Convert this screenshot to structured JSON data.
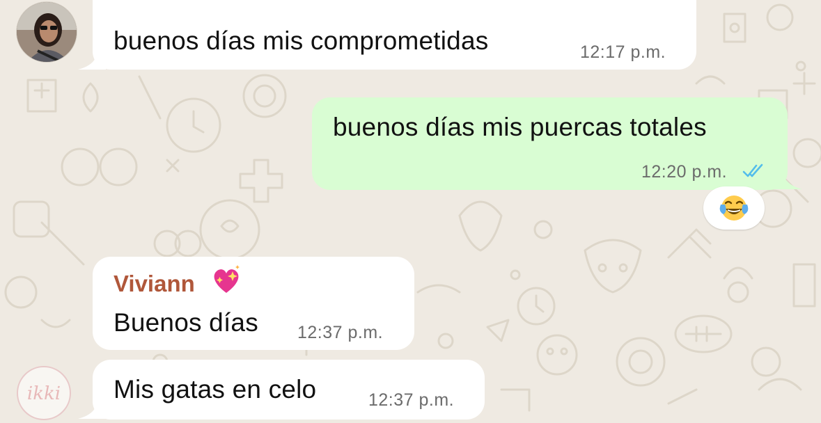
{
  "chat": {
    "messages": [
      {
        "type": "incoming",
        "text": "buenos días mis comprometidas",
        "time": "12:17 p.m."
      },
      {
        "type": "outgoing",
        "text": "buenos días mis puercas totales",
        "time": "12:20 p.m.",
        "status": "read",
        "reaction": "face-with-tears-of-joy"
      },
      {
        "type": "incoming",
        "sender": "Viviann",
        "text": "Buenos días",
        "time": "12:37 p.m."
      },
      {
        "type": "incoming",
        "text": "Mis gatas en celo",
        "time": "12:37 p.m."
      }
    ]
  },
  "watermark": {
    "text": "ikki"
  },
  "colors": {
    "background": "#efeae2",
    "incoming_bubble": "#ffffff",
    "outgoing_bubble": "#d9fdd3",
    "sender_name": "#b0573a",
    "read_ticks": "#53bdeb",
    "timestamp": "#6b6b6b"
  },
  "icons": {
    "read_receipt": "double-check-icon",
    "sender_emoji": "sparkling-heart-icon",
    "reaction_emoji": "face-with-tears-of-joy-icon"
  }
}
